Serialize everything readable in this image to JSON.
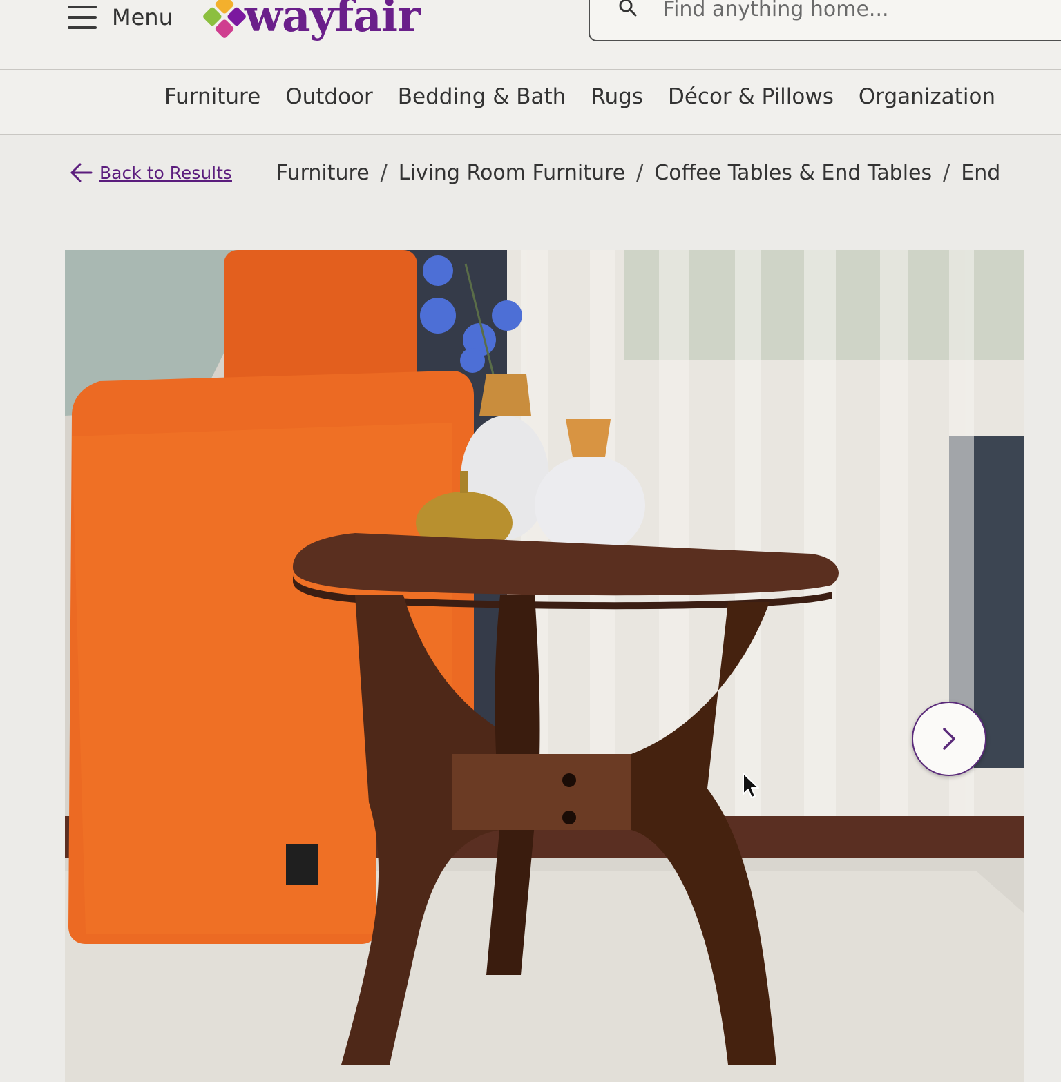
{
  "header": {
    "menu_label": "Menu",
    "logo_text": "wayfair",
    "search": {
      "placeholder": "Find anything home..."
    }
  },
  "nav": {
    "items": [
      {
        "label": "Furniture"
      },
      {
        "label": "Outdoor"
      },
      {
        "label": "Bedding & Bath"
      },
      {
        "label": "Rugs"
      },
      {
        "label": "Décor & Pillows"
      },
      {
        "label": "Organization"
      }
    ]
  },
  "breadcrumb": {
    "back_label": "Back to Results",
    "items": [
      {
        "label": "Furniture"
      },
      {
        "label": "Living Room Furniture"
      },
      {
        "label": "Coffee Tables & End Tables"
      },
      {
        "label": "End"
      }
    ],
    "separator": "/"
  },
  "colors": {
    "brand_purple": "#6a1f8a",
    "link_purple": "#5b1d7d",
    "logo_yellow": "#f3b02d",
    "logo_green": "#8cbf3f",
    "logo_magenta": "#cf3e8f"
  },
  "icons": [
    "menu-icon",
    "search-icon",
    "back-arrow-icon",
    "chevron-right-icon",
    "mouse-cursor-icon"
  ]
}
